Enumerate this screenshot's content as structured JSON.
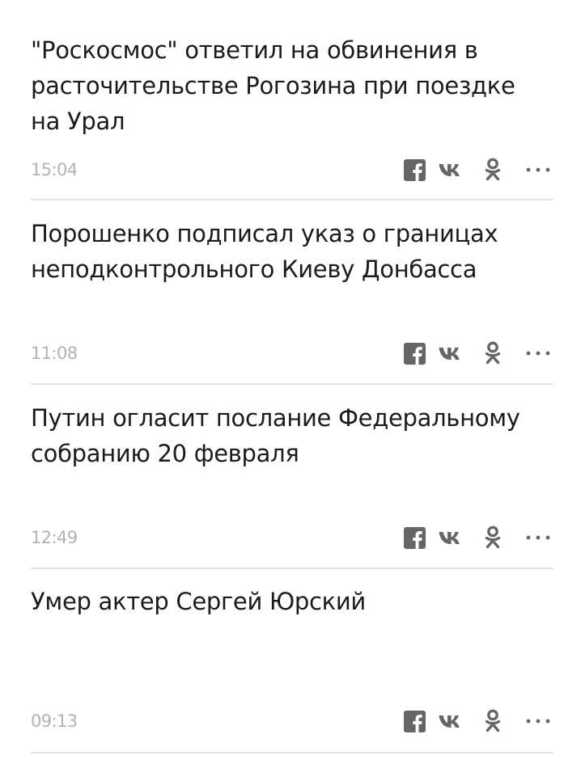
{
  "news": [
    {
      "title": "\"Роскосмос\" ответил на обвинения в расточительстве Рогозина при поездке на Урал",
      "time": "15:04"
    },
    {
      "title": "Порошенко подписал указ о границах неподконтрольного Киеву Донбасса",
      "time": "11:08"
    },
    {
      "title": "Путин огласит послание Федеральному собранию 20 февраля",
      "time": "12:49"
    },
    {
      "title": "Умер актер Сергей Юрский",
      "time": "09:13"
    }
  ],
  "share_icons": [
    "facebook-icon",
    "vk-icon",
    "odnoklassniki-icon",
    "more-icon"
  ],
  "colors": {
    "headline": "#1b1b1b",
    "time": "#b3b3b3",
    "icon": "#666666",
    "divider": "#e3e3e3"
  }
}
